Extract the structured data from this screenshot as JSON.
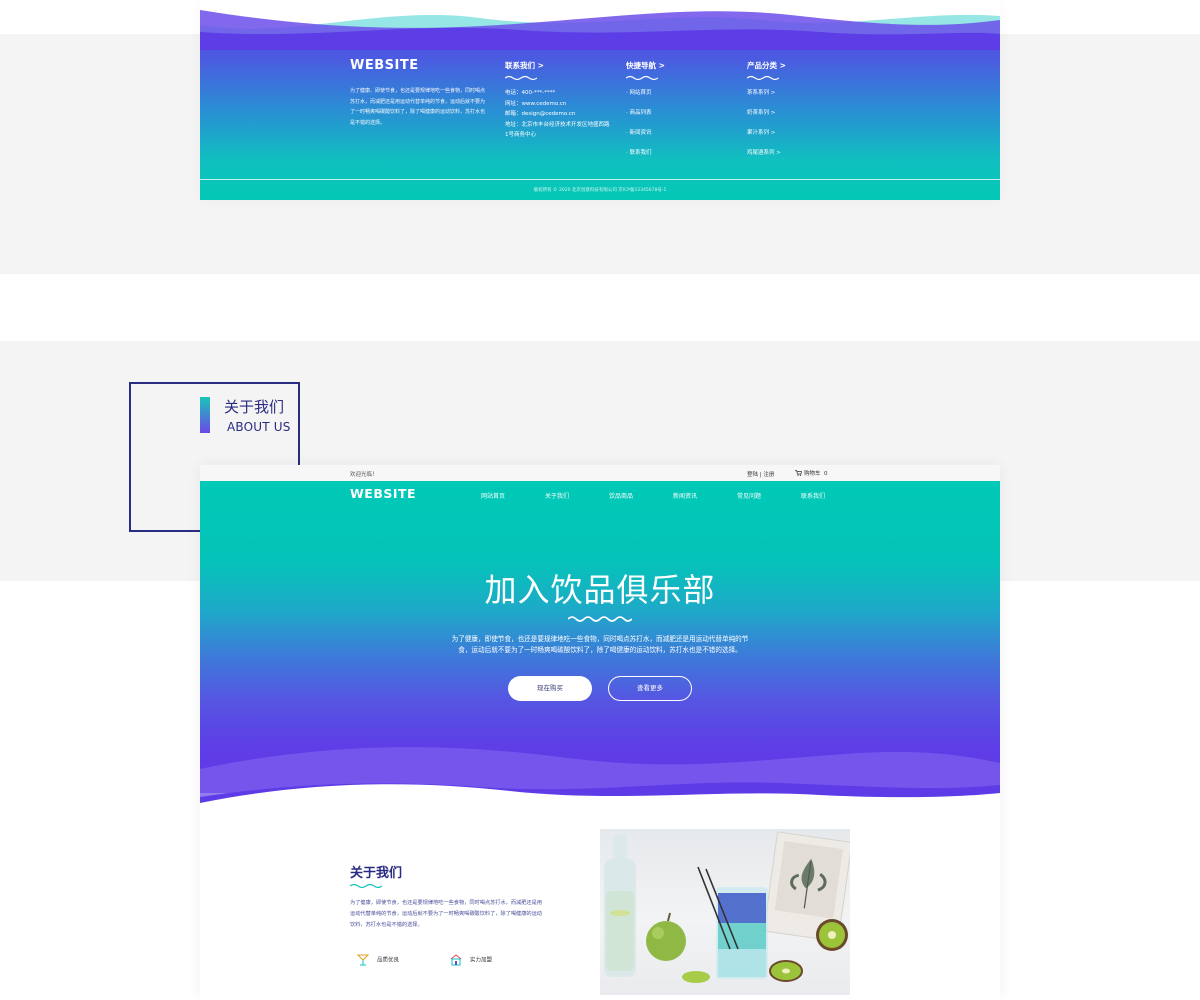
{
  "footer": {
    "logo": "WEBSITE",
    "description": "为了健康、即使节食，也还是要规律地吃一些食物，同时喝点苏打水，而减肥还是用运动代替单纯的节食，运动后就不要为了一时畅爽喝碳酸饮料了，除了喝健康的运动饮料，苏打水也是不错的选择。",
    "contact": {
      "heading": "联系我们  >",
      "phone": "电话：400-***-****",
      "web": "网址：www.cedemo.cn",
      "email": "邮箱：design@cedemo.cn",
      "address": "地址：北京市丰台经济技术开发区地盛西路1号商务中心"
    },
    "quicknav": {
      "heading": "快捷导航  >",
      "items": [
        "· 网站首页",
        "· 商品列表",
        "· 新闻资讯",
        "· 联系我们"
      ]
    },
    "category": {
      "heading": "产品分类  >",
      "items": [
        "茶系系列 >",
        "奶茶系列 >",
        "果汁系列 >",
        "鸡尾酒系列 >"
      ]
    },
    "copyright": "版权所有 © 2020 北京创意科技有限公司    京ICP备12345678号-1"
  },
  "label": {
    "cn": "关于我们",
    "en": "ABOUT US"
  },
  "page": {
    "topbar": {
      "welcome": "欢迎光临！",
      "login": "登陆 | 注册",
      "cart": "购物车",
      "cart_count": "0"
    },
    "logo": "WEBSITE",
    "nav": [
      "网站首页",
      "关于我们",
      "饮品商品",
      "新闻资讯",
      "常见问题",
      "联系我们"
    ],
    "hero": {
      "title": "加入饮品俱乐部",
      "desc": "为了健康，即使节食，也还是要规律地吃一些食物，同时喝点苏打水，而减肥还是用运动代替单纯的节食，运动后就不要为了一时畅爽喝碳酸饮料了，除了喝健康的运动饮料，苏打水也是不错的选择。",
      "buy_button": "现在购买",
      "more_button": "查看更多"
    },
    "about": {
      "title": "关于我们",
      "text": "为了健康，即使节食，也还是要规律地吃一些食物，同时喝点苏打水，而减肥还是用运动代替单纯的节食，运动后就不要为了一时畅爽喝碳酸饮料了，除了喝健康的运动饮料，苏打水也是不错的选择。",
      "features": [
        "品质优良",
        "实力加盟"
      ]
    }
  },
  "colors": {
    "brand_teal": "#00c9b6",
    "brand_purple": "#5e3ee6",
    "brand_navy": "#2a2c82",
    "band_gray": "#f4f4f4"
  }
}
